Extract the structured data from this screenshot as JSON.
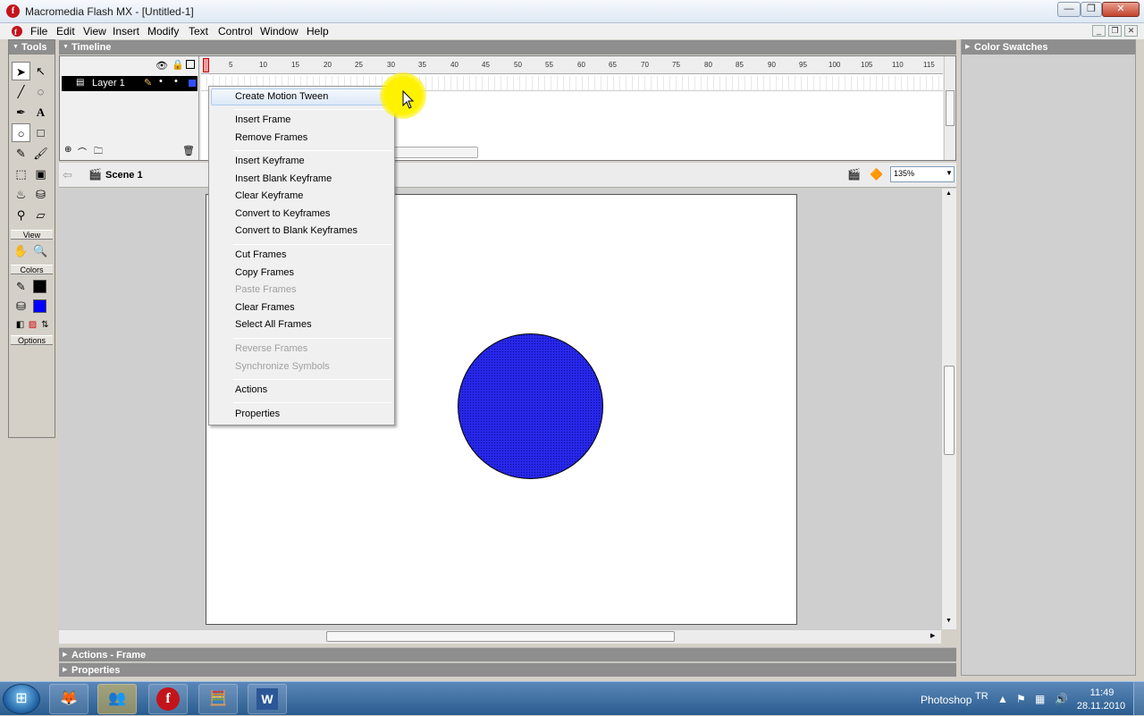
{
  "window": {
    "title": "Macromedia Flash MX - [Untitled-1]",
    "app_icon": "flash-icon",
    "buttons": [
      "minimize-icon",
      "restore-icon",
      "close-icon"
    ],
    "minimize_glyph": "—",
    "restore_glyph": "❐",
    "close_glyph": "✕"
  },
  "menubar": {
    "items": [
      "File",
      "Edit",
      "View",
      "Insert",
      "Modify",
      "Text",
      "Control",
      "Window",
      "Help"
    ]
  },
  "tools": {
    "header": "Tools",
    "view_label": "View",
    "colors_label": "Colors",
    "options_label": "Options",
    "stroke_color": "#000000",
    "fill_color": "#0000ff"
  },
  "timeline": {
    "header": "Timeline",
    "layer_name": "Layer 1",
    "frame_numbers": [
      "5",
      "10",
      "15",
      "20",
      "25",
      "30",
      "35",
      "40",
      "45",
      "50",
      "55",
      "60",
      "65",
      "70",
      "75",
      "80",
      "85",
      "90",
      "95",
      "100",
      "105",
      "110",
      "115"
    ]
  },
  "scene": {
    "name": "Scene 1",
    "zoom": "135%"
  },
  "stage": {
    "circle_color": "#2727e8"
  },
  "context_menu": {
    "groups": [
      [
        {
          "label": "Create Motion Tween",
          "enabled": true,
          "highlighted": true
        }
      ],
      [
        {
          "label": "Insert Frame",
          "enabled": true
        },
        {
          "label": "Remove Frames",
          "enabled": true
        }
      ],
      [
        {
          "label": "Insert Keyframe",
          "enabled": true
        },
        {
          "label": "Insert Blank Keyframe",
          "enabled": true
        },
        {
          "label": "Clear Keyframe",
          "enabled": true
        },
        {
          "label": "Convert to Keyframes",
          "enabled": true
        },
        {
          "label": "Convert to Blank Keyframes",
          "enabled": true
        }
      ],
      [
        {
          "label": "Cut Frames",
          "enabled": true
        },
        {
          "label": "Copy Frames",
          "enabled": true
        },
        {
          "label": "Paste Frames",
          "enabled": false
        },
        {
          "label": "Clear Frames",
          "enabled": true
        },
        {
          "label": "Select All Frames",
          "enabled": true
        }
      ],
      [
        {
          "label": "Reverse Frames",
          "enabled": false
        },
        {
          "label": "Synchronize Symbols",
          "enabled": false
        }
      ],
      [
        {
          "label": "Actions",
          "enabled": true
        }
      ],
      [
        {
          "label": "Properties",
          "enabled": true
        }
      ]
    ]
  },
  "bottom_panels": [
    "Actions - Frame",
    "Properties"
  ],
  "right_panel": {
    "header": "Color Swatches"
  },
  "taskbar": {
    "apps": [
      "firefox-icon",
      "messenger-icon",
      "flash-icon",
      "calculator-icon",
      "word-icon"
    ],
    "tray_app": "Photoshop",
    "language": "TR",
    "time": "11:49",
    "date": "28.11.2010"
  }
}
